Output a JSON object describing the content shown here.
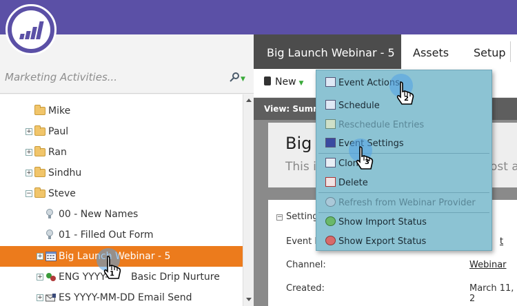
{
  "search": {
    "placeholder": "Marketing Activities..."
  },
  "tree": {
    "items": [
      {
        "label": "Mike"
      },
      {
        "label": "Paul"
      },
      {
        "label": "Ran"
      },
      {
        "label": "Sindhu"
      },
      {
        "label": "Steve"
      },
      {
        "label": "00 - New Names"
      },
      {
        "label": "01 - Filled Out Form"
      },
      {
        "label": "Big Launch Webinar - 5"
      },
      {
        "label": "ENG YYYY-",
        "label_end": "Basic Drip Nurture"
      },
      {
        "label": "ES YYYY-MM-DD Email Send"
      }
    ]
  },
  "tabs": {
    "active": "Big Launch Webinar - 5",
    "assets": "Assets",
    "setup": "Setup"
  },
  "toolbar": {
    "new_label": "New"
  },
  "view": {
    "label": "View: Summ"
  },
  "summary": {
    "title": "Big",
    "desc_start": "This i",
    "desc_end": "ost al"
  },
  "settings": {
    "section": "Setting",
    "event_label": "Event F",
    "event_value_end": "t",
    "channel_label": "Channel:",
    "channel_value": "Webinar",
    "created_label": "Created:",
    "created_value": "March 11, 2"
  },
  "menu": {
    "header": "Event Actions",
    "items": [
      {
        "label": "Schedule",
        "enabled": true
      },
      {
        "label": "Reschedule Entries",
        "enabled": false
      },
      {
        "label": "Event Settings",
        "enabled": true
      },
      {
        "label": "Clone",
        "enabled": true
      },
      {
        "label": "Delete",
        "enabled": true
      },
      {
        "label": "Refresh from Webinar Provider",
        "enabled": false
      },
      {
        "label": "Show Import Status",
        "enabled": true
      },
      {
        "label": "Show Export Status",
        "enabled": true
      }
    ]
  },
  "steps": {
    "one": "1",
    "two": "2",
    "three": "3"
  },
  "colors": {
    "topbar": "#5b50a6",
    "selection": "#ec7b1c",
    "menu_bg": "#8cc3d3",
    "active_tab": "#4c4c4c"
  }
}
